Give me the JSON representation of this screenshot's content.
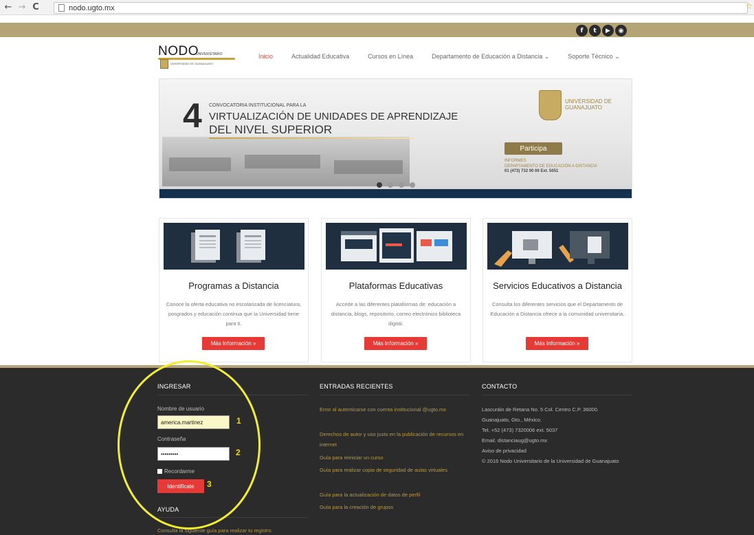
{
  "browser": {
    "url": "nodo.ugto.mx",
    "back_glyph": "←",
    "forward_glyph": "→",
    "reload_glyph": "C",
    "star_glyph": "☆"
  },
  "social": [
    "f",
    "t",
    "▶",
    "◉"
  ],
  "logo": {
    "word": "NODO",
    "sub": "UNIVERSITARIO",
    "tiny": "UNIVERSIDAD DE GUANAJUATO"
  },
  "nav": [
    {
      "label": "Inicio",
      "active": true
    },
    {
      "label": "Actualidad Educativa",
      "active": false
    },
    {
      "label": "Cursos en Línea",
      "active": false
    },
    {
      "label": "Departamento de Educación a Distancia ⌄",
      "active": false
    },
    {
      "label": "Soporte Técnico ⌄",
      "active": false
    }
  ],
  "slider": {
    "number": "4",
    "kicker": "CONVOCATORIA INSTITUCIONAL PARA LA",
    "title1": "VIRTUALIZACIÓN DE UNIDADES DE APRENDIZAJE",
    "title2": "DEL NIVEL SUPERIOR",
    "university": [
      "UNIVERSIDAD DE",
      "GUANAJUATO"
    ],
    "cta": "Participa",
    "informes": [
      "INFORMES",
      "DEPARTAMENTO DE EDUCACIÓN A DISTANCIA"
    ],
    "phone": "01 (473) 732 00 06 Ext. 5051",
    "active_dot": 0,
    "dot_count": 4
  },
  "cards": [
    {
      "title": "Programas a Distancia",
      "desc": "Conoce la oferta educativa no escolarizada de licenciatura, posgrados y educación continua que la Universidad tiene para ti.",
      "button": "Más Información »"
    },
    {
      "title": "Plataformas Educativas",
      "desc": "Accede a las diferentes plataformas de: educación a distancia, blogs, repositorio, correo electrónico biblioteca digital.",
      "button": "Más Información »"
    },
    {
      "title": "Servicios Educativos a Distancia",
      "desc": "Consulta los diferentes servicios que el Departamento de Educación a Distancia ofrece a la comunidad universitaria.",
      "button": "Más Información »"
    }
  ],
  "login": {
    "heading": "INGRESAR",
    "user_label": "Nombre de usuario",
    "user_value": "america.martinez",
    "pass_label": "Contraseña",
    "pass_value": "•••••••••",
    "remember": "Recordarme",
    "button": "Identifícate",
    "annotations": [
      "1",
      "2",
      "3"
    ]
  },
  "ayuda": {
    "heading": "AYUDA",
    "text": "Consulta la siguiente guía para realizar tu registro."
  },
  "recent": {
    "heading": "ENTRADAS RECIENTES",
    "items": [
      "Error al autenticarse con cuenta institucional @ugto.mx",
      "Derechos de autor y uso justo en la publicación de recursos en internet",
      "Guía para reiniciar un curso",
      "Guía para realizar copia de seguridad de aulas virtuales",
      "Guía para la actualización de datos de perfil",
      "Guía para la creación de grupos"
    ]
  },
  "contact": {
    "heading": "CONTACTO",
    "lines": [
      "Lascuráin de Retana No. 5 Col. Centro C.P. 36000.",
      "Guanajuato, Gto., México.",
      "Tel. +52 (473) 7320006 ext. 5037",
      "Email. distanciaug@ugto.mx"
    ],
    "privacy": "Aviso de privacidad",
    "copyright": "© 2016 Nodo Universitario de la Universidad de Guanajuato"
  }
}
